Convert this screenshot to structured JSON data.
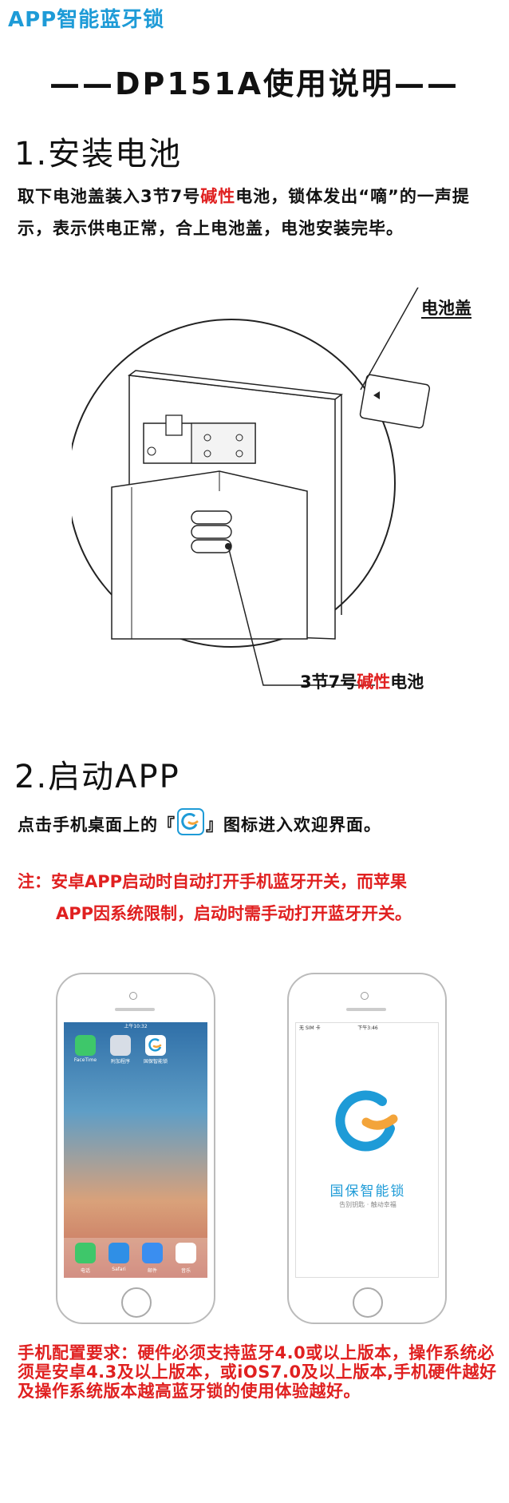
{
  "header": {
    "brand": "APP智能蓝牙锁",
    "title": "——DP151A使用说明——"
  },
  "section1": {
    "heading": "1.安装电池",
    "para_a": "取下电池盖装入3节7号",
    "para_red": "碱性",
    "para_b": "电池，锁体发出“嘀”的一声提示，表示供电正常，合上电池盖，电池安装完毕。",
    "cover_label": "电池盖",
    "battery_label_a": "3节7号",
    "battery_label_red": "碱性",
    "battery_label_b": "电池"
  },
  "section2": {
    "heading": "2.启动APP",
    "line_a": "点击手机桌面上的『",
    "line_b": "』图标进入欢迎界面。",
    "note_line1": "注：安卓APP启动时自动打开手机蓝牙开关，而苹果",
    "note_line2": "APP因系统限制，启动时需手动打开蓝牙开关。"
  },
  "phone_home": {
    "status_time": "上午10:32",
    "apps": [
      "FaceTime",
      "附加程序",
      "国保智能锁"
    ],
    "dock": [
      "电话",
      "Safari",
      "邮件",
      "音乐"
    ]
  },
  "phone_splash": {
    "status_left": "无 SIM 卡",
    "status_time": "下午3:46",
    "app_name": "国保智能锁",
    "slogan": "告别钥匙 · 触动幸福"
  },
  "requirements": {
    "text": "手机配置要求：硬件必须支持蓝牙4.0或以上版本，操作系统必须是安卓4.3及以上版本，或iOS7.0及以上版本,手机硬件越好及操作系统版本越高蓝牙锁的使用体验越好。"
  },
  "colors": {
    "brand_blue": "#1e9bd7",
    "accent_red": "#e02020",
    "logo_orange": "#f3a43a"
  }
}
